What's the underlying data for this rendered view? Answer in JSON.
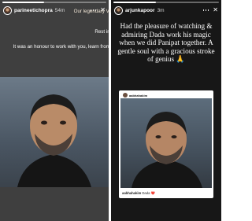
{
  "left_story": {
    "username": "parineetichopra",
    "timestamp": "54m",
    "progress": 0.4,
    "caption": "Our legendary Vikram Dada 💕🙏",
    "rip": "Rest in Peace.",
    "message": "It was an honour to work with you, learn from you, see your magic. Eternally in awe of you."
  },
  "right_story": {
    "username": "arjunkapoor",
    "timestamp": "3m",
    "progress": 0.4,
    "quote": "Had the pleasure of watching & admiring Dada work his magic when we did Panipat together. A gentle soul with a gracious stroke of genius 🙏",
    "shared_post": {
      "username": "aabhahakim",
      "footer_user": "aabhahakim",
      "footer_text": "Dada",
      "footer_emoji": "❤️"
    }
  },
  "colors": {
    "left_bg": "#3f3f3f",
    "right_bg": "#171717",
    "caption_tint": "#f1e6d6"
  },
  "icons": [
    "avatar",
    "more-icon",
    "close-icon",
    "heart-icon"
  ]
}
